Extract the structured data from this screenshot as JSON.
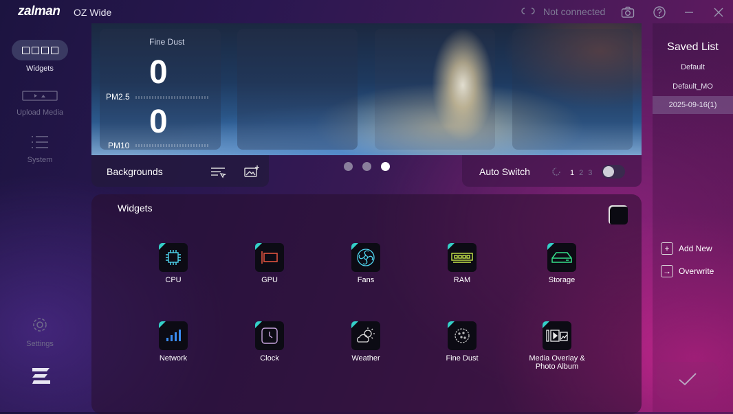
{
  "titlebar": {
    "logo": "zalman",
    "app_title": "OZ Wide",
    "connection_status": "Not connected"
  },
  "nav": {
    "widgets": "Widgets",
    "upload_media": "Upload Media",
    "system": "System",
    "settings": "Settings"
  },
  "preview": {
    "fine_dust_label": "Fine Dust",
    "pm25_value": "0",
    "pm25_label": "PM2.5",
    "pm10_value": "0",
    "pm10_label": "PM10"
  },
  "backgrounds": {
    "label": "Backgrounds"
  },
  "pager": {
    "pages": 3,
    "current": 3
  },
  "auto_switch": {
    "label": "Auto Switch",
    "steps": [
      "1",
      "2",
      "3"
    ],
    "enabled": false
  },
  "widgets_panel": {
    "title": "Widgets",
    "items": [
      {
        "label": "CPU",
        "icon": "cpu-icon"
      },
      {
        "label": "GPU",
        "icon": "gpu-icon"
      },
      {
        "label": "Fans",
        "icon": "fan-icon"
      },
      {
        "label": "RAM",
        "icon": "ram-icon"
      },
      {
        "label": "Storage",
        "icon": "storage-icon"
      },
      {
        "label": "Network",
        "icon": "network-icon"
      },
      {
        "label": "Clock",
        "icon": "clock-icon"
      },
      {
        "label": "Weather",
        "icon": "weather-icon"
      },
      {
        "label": "Fine Dust",
        "icon": "fine-dust-icon"
      },
      {
        "label": "Media Overlay &\nPhoto Album",
        "icon": "media-icon"
      }
    ]
  },
  "saved_list": {
    "title": "Saved List",
    "items": [
      "Default",
      "Default_MO",
      "2025-09-16(1)"
    ],
    "selected": 2,
    "add_new": "Add New",
    "overwrite": "Overwrite"
  },
  "colors": {
    "accent": "#34d0c8",
    "selected": "#8a6a98"
  }
}
